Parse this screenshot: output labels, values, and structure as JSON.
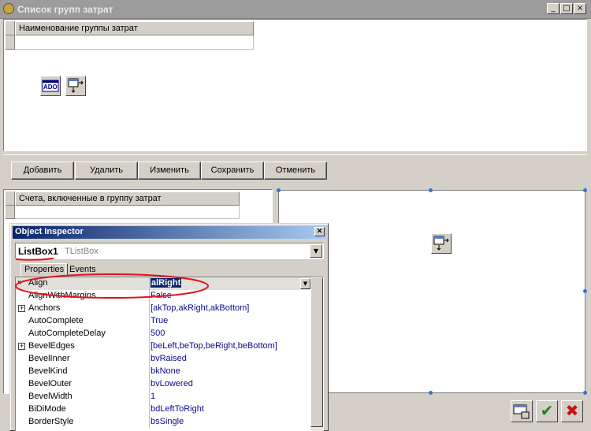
{
  "window": {
    "title": "Список групп затрат",
    "controls": [
      "_",
      "□",
      "×"
    ]
  },
  "top_grid": {
    "header": "Наименование группы затрат"
  },
  "buttons": [
    {
      "label": "Добавить"
    },
    {
      "label": "Удалить"
    },
    {
      "label": "Изменить"
    },
    {
      "label": "Сохранить"
    },
    {
      "label": "Отменить"
    }
  ],
  "bottom_grid": {
    "header": "Счета, включенные в группу затрат"
  },
  "inspector": {
    "title": "Object Inspector",
    "component_name": "ListBox1",
    "component_type": "TListBox",
    "tabs": [
      "Properties",
      "Events"
    ],
    "properties": [
      {
        "name": "Align",
        "value": "alRight",
        "selected": true
      },
      {
        "name": "AlignWithMargins",
        "value": "False"
      },
      {
        "name": "Anchors",
        "value": "[akTop,akRight,akBottom]",
        "expandable": true
      },
      {
        "name": "AutoComplete",
        "value": "True"
      },
      {
        "name": "AutoCompleteDelay",
        "value": "500"
      },
      {
        "name": "BevelEdges",
        "value": "[beLeft,beTop,beRight,beBottom]",
        "expandable": true
      },
      {
        "name": "BevelInner",
        "value": "bvRaised"
      },
      {
        "name": "BevelKind",
        "value": "bkNone"
      },
      {
        "name": "BevelOuter",
        "value": "bvLowered"
      },
      {
        "name": "BevelWidth",
        "value": "1"
      },
      {
        "name": "BiDiMode",
        "value": "bdLeftToRight"
      },
      {
        "name": "BorderStyle",
        "value": "bsSingle"
      }
    ]
  },
  "colors": {
    "annotation": "#e0141e",
    "selection": "#0a246a",
    "accept": "#1a8a1a",
    "cancel": "#c81414"
  },
  "icons": {
    "ado_label": "ADO",
    "accept_glyph": "✔",
    "cancel_glyph": "✖"
  }
}
